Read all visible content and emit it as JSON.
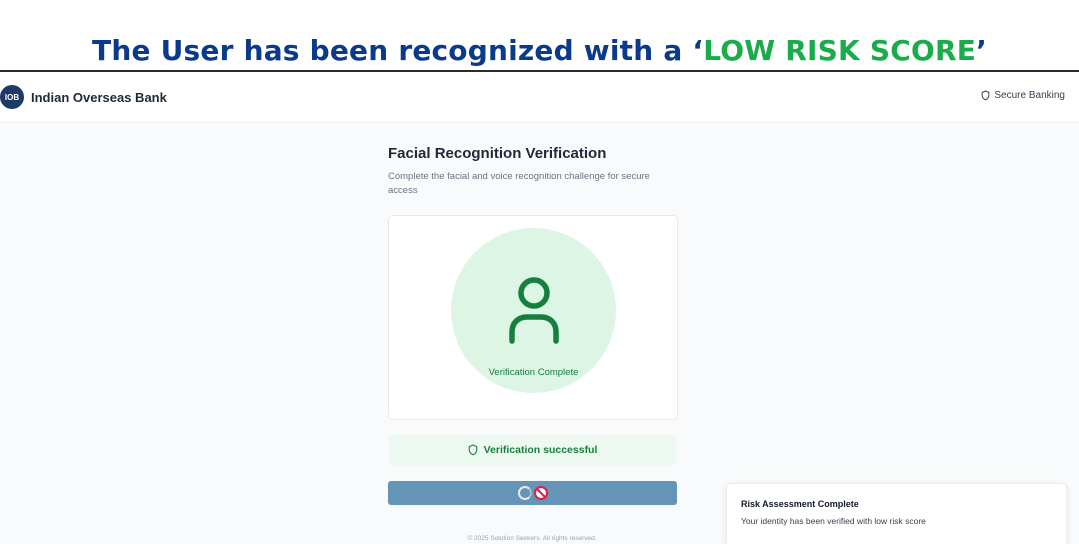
{
  "caption": {
    "prefix": "The User has been recognized with a ‘",
    "highlight": "LOW RISK SCORE",
    "suffix": "’",
    "colors": {
      "main": "#0b3a8a",
      "highlight": "#1aab4b"
    }
  },
  "header": {
    "logo_text": "IOB",
    "brand_name": "Indian Overseas Bank",
    "secure_label": "Secure Banking",
    "secure_icon": "shield-icon"
  },
  "main": {
    "title": "Facial Recognition Verification",
    "subtitle": "Complete the facial and voice recognition challenge for secure access",
    "verification_card": {
      "icon": "user-icon",
      "status_label": "Verification Complete"
    },
    "success_banner": {
      "icon": "shield-icon",
      "label": "Verification successful"
    },
    "continue_button": {
      "icons": [
        "spinner-icon",
        "not-allowed-icon"
      ]
    },
    "footer": "© 2025 Solution Seekers. All rights reserved."
  },
  "toast": {
    "title": "Risk Assessment Complete",
    "description": "Your identity has been verified with low risk score"
  },
  "colors": {
    "brand_navy": "#1e3a68",
    "success_green": "#15803d",
    "circle_green": "#dcf5e5",
    "button_blue": "#6494b6"
  }
}
